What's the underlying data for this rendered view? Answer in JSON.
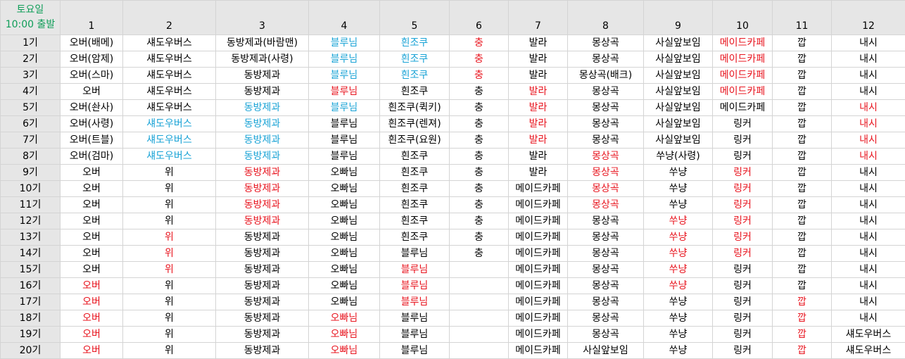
{
  "colors": {
    "black": "#000000",
    "red": "#e8141e",
    "blue": "#1aa3d6",
    "green": "#0f9d58",
    "header_bg": "#e6e6e6",
    "grid": "#d4d4d4"
  },
  "corner": {
    "day": "토요일",
    "time": "10:00 출발"
  },
  "columns": [
    "1",
    "2",
    "3",
    "4",
    "5",
    "6",
    "7",
    "8",
    "9",
    "10",
    "11",
    "12"
  ],
  "rows": [
    {
      "label": "1기",
      "cells": [
        {
          "t": "오버(배메)",
          "c": "k"
        },
        {
          "t": "섀도우버스",
          "c": "k"
        },
        {
          "t": "동방제과(바람맨)",
          "c": "k"
        },
        {
          "t": "블루님",
          "c": "b"
        },
        {
          "t": "흰조쿠",
          "c": "b"
        },
        {
          "t": "충",
          "c": "r"
        },
        {
          "t": "발라",
          "c": "k"
        },
        {
          "t": "몽상곡",
          "c": "k"
        },
        {
          "t": "사실앞보임",
          "c": "k"
        },
        {
          "t": "메이드카페",
          "c": "r"
        },
        {
          "t": "깝",
          "c": "k"
        },
        {
          "t": "내시",
          "c": "k"
        }
      ]
    },
    {
      "label": "2기",
      "cells": [
        {
          "t": "오버(암제)",
          "c": "k"
        },
        {
          "t": "섀도우버스",
          "c": "k"
        },
        {
          "t": "동방제과(사령)",
          "c": "k"
        },
        {
          "t": "블루님",
          "c": "b"
        },
        {
          "t": "흰조쿠",
          "c": "b"
        },
        {
          "t": "충",
          "c": "r"
        },
        {
          "t": "발라",
          "c": "k"
        },
        {
          "t": "몽상곡",
          "c": "k"
        },
        {
          "t": "사실앞보임",
          "c": "k"
        },
        {
          "t": "메이드카페",
          "c": "r"
        },
        {
          "t": "깝",
          "c": "k"
        },
        {
          "t": "내시",
          "c": "k"
        }
      ]
    },
    {
      "label": "3기",
      "cells": [
        {
          "t": "오버(스마)",
          "c": "k"
        },
        {
          "t": "섀도우버스",
          "c": "k"
        },
        {
          "t": "동방제과",
          "c": "k"
        },
        {
          "t": "블루님",
          "c": "b"
        },
        {
          "t": "흰조쿠",
          "c": "b"
        },
        {
          "t": "충",
          "c": "r"
        },
        {
          "t": "발라",
          "c": "k"
        },
        {
          "t": "몽상곡(배크)",
          "c": "k"
        },
        {
          "t": "사실앞보임",
          "c": "k"
        },
        {
          "t": "메이드카페",
          "c": "r"
        },
        {
          "t": "깝",
          "c": "k"
        },
        {
          "t": "내시",
          "c": "k"
        }
      ]
    },
    {
      "label": "4기",
      "cells": [
        {
          "t": "오버",
          "c": "k"
        },
        {
          "t": "섀도우버스",
          "c": "k"
        },
        {
          "t": "동방제과",
          "c": "k"
        },
        {
          "t": "블루님",
          "c": "r"
        },
        {
          "t": "흰조쿠",
          "c": "k"
        },
        {
          "t": "충",
          "c": "k"
        },
        {
          "t": "발라",
          "c": "r"
        },
        {
          "t": "몽상곡",
          "c": "k"
        },
        {
          "t": "사실앞보임",
          "c": "k"
        },
        {
          "t": "메이드카페",
          "c": "r"
        },
        {
          "t": "깝",
          "c": "k"
        },
        {
          "t": "내시",
          "c": "k"
        }
      ]
    },
    {
      "label": "5기",
      "cells": [
        {
          "t": "오버(솬사)",
          "c": "k"
        },
        {
          "t": "섀도우버스",
          "c": "k"
        },
        {
          "t": "동방제과",
          "c": "b"
        },
        {
          "t": "블루님",
          "c": "b"
        },
        {
          "t": "흰조쿠(퀵키)",
          "c": "k"
        },
        {
          "t": "충",
          "c": "k"
        },
        {
          "t": "발라",
          "c": "r"
        },
        {
          "t": "몽상곡",
          "c": "k"
        },
        {
          "t": "사실앞보임",
          "c": "k"
        },
        {
          "t": "메이드카페",
          "c": "k"
        },
        {
          "t": "깝",
          "c": "k"
        },
        {
          "t": "내시",
          "c": "r"
        }
      ]
    },
    {
      "label": "6기",
      "cells": [
        {
          "t": "오버(사령)",
          "c": "k"
        },
        {
          "t": "섀도우버스",
          "c": "b"
        },
        {
          "t": "동방제과",
          "c": "b"
        },
        {
          "t": "블루님",
          "c": "k"
        },
        {
          "t": "흰조쿠(렌져)",
          "c": "k"
        },
        {
          "t": "충",
          "c": "k"
        },
        {
          "t": "발라",
          "c": "r"
        },
        {
          "t": "몽상곡",
          "c": "k"
        },
        {
          "t": "사실앞보임",
          "c": "k"
        },
        {
          "t": "링커",
          "c": "k"
        },
        {
          "t": "깝",
          "c": "k"
        },
        {
          "t": "내시",
          "c": "r"
        }
      ]
    },
    {
      "label": "7기",
      "cells": [
        {
          "t": "오버(트블)",
          "c": "k"
        },
        {
          "t": "섀도우버스",
          "c": "b"
        },
        {
          "t": "동방제과",
          "c": "b"
        },
        {
          "t": "블루님",
          "c": "k"
        },
        {
          "t": "흰조쿠(요원)",
          "c": "k"
        },
        {
          "t": "충",
          "c": "k"
        },
        {
          "t": "발라",
          "c": "r"
        },
        {
          "t": "몽상곡",
          "c": "k"
        },
        {
          "t": "사실앞보임",
          "c": "k"
        },
        {
          "t": "링커",
          "c": "k"
        },
        {
          "t": "깝",
          "c": "k"
        },
        {
          "t": "내시",
          "c": "r"
        }
      ]
    },
    {
      "label": "8기",
      "cells": [
        {
          "t": "오버(검마)",
          "c": "k"
        },
        {
          "t": "섀도우버스",
          "c": "b"
        },
        {
          "t": "동방제과",
          "c": "b"
        },
        {
          "t": "블루님",
          "c": "k"
        },
        {
          "t": "흰조쿠",
          "c": "k"
        },
        {
          "t": "충",
          "c": "k"
        },
        {
          "t": "발라",
          "c": "k"
        },
        {
          "t": "몽상곡",
          "c": "r"
        },
        {
          "t": "쑤냥(사령)",
          "c": "k"
        },
        {
          "t": "링커",
          "c": "k"
        },
        {
          "t": "깝",
          "c": "k"
        },
        {
          "t": "내시",
          "c": "r"
        }
      ]
    },
    {
      "label": "9기",
      "cells": [
        {
          "t": "오버",
          "c": "k"
        },
        {
          "t": "위",
          "c": "k"
        },
        {
          "t": "동방제과",
          "c": "r"
        },
        {
          "t": "오빠님",
          "c": "k"
        },
        {
          "t": "흰조쿠",
          "c": "k"
        },
        {
          "t": "충",
          "c": "k"
        },
        {
          "t": "발라",
          "c": "k"
        },
        {
          "t": "몽상곡",
          "c": "r"
        },
        {
          "t": "쑤냥",
          "c": "k"
        },
        {
          "t": "링커",
          "c": "r"
        },
        {
          "t": "깝",
          "c": "k"
        },
        {
          "t": "내시",
          "c": "k"
        }
      ]
    },
    {
      "label": "10기",
      "cells": [
        {
          "t": "오버",
          "c": "k"
        },
        {
          "t": "위",
          "c": "k"
        },
        {
          "t": "동방제과",
          "c": "r"
        },
        {
          "t": "오빠님",
          "c": "k"
        },
        {
          "t": "흰조쿠",
          "c": "k"
        },
        {
          "t": "충",
          "c": "k"
        },
        {
          "t": "메이드카페",
          "c": "k"
        },
        {
          "t": "몽상곡",
          "c": "r"
        },
        {
          "t": "쑤냥",
          "c": "k"
        },
        {
          "t": "링커",
          "c": "r"
        },
        {
          "t": "깝",
          "c": "k"
        },
        {
          "t": "내시",
          "c": "k"
        }
      ]
    },
    {
      "label": "11기",
      "cells": [
        {
          "t": "오버",
          "c": "k"
        },
        {
          "t": "위",
          "c": "k"
        },
        {
          "t": "동방제과",
          "c": "r"
        },
        {
          "t": "오빠님",
          "c": "k"
        },
        {
          "t": "흰조쿠",
          "c": "k"
        },
        {
          "t": "충",
          "c": "k"
        },
        {
          "t": "메이드카페",
          "c": "k"
        },
        {
          "t": "몽상곡",
          "c": "r"
        },
        {
          "t": "쑤냥",
          "c": "k"
        },
        {
          "t": "링커",
          "c": "r"
        },
        {
          "t": "깝",
          "c": "k"
        },
        {
          "t": "내시",
          "c": "k"
        }
      ]
    },
    {
      "label": "12기",
      "cells": [
        {
          "t": "오버",
          "c": "k"
        },
        {
          "t": "위",
          "c": "k"
        },
        {
          "t": "동방제과",
          "c": "r"
        },
        {
          "t": "오빠님",
          "c": "k"
        },
        {
          "t": "흰조쿠",
          "c": "k"
        },
        {
          "t": "충",
          "c": "k"
        },
        {
          "t": "메이드카페",
          "c": "k"
        },
        {
          "t": "몽상곡",
          "c": "k"
        },
        {
          "t": "쑤냥",
          "c": "r"
        },
        {
          "t": "링커",
          "c": "r"
        },
        {
          "t": "깝",
          "c": "k"
        },
        {
          "t": "내시",
          "c": "k"
        }
      ]
    },
    {
      "label": "13기",
      "cells": [
        {
          "t": "오버",
          "c": "k"
        },
        {
          "t": "위",
          "c": "r"
        },
        {
          "t": "동방제과",
          "c": "k"
        },
        {
          "t": "오빠님",
          "c": "k"
        },
        {
          "t": "흰조쿠",
          "c": "k"
        },
        {
          "t": "충",
          "c": "k"
        },
        {
          "t": "메이드카페",
          "c": "k"
        },
        {
          "t": "몽상곡",
          "c": "k"
        },
        {
          "t": "쑤냥",
          "c": "r"
        },
        {
          "t": "링커",
          "c": "r"
        },
        {
          "t": "깝",
          "c": "k"
        },
        {
          "t": "내시",
          "c": "k"
        }
      ]
    },
    {
      "label": "14기",
      "cells": [
        {
          "t": "오버",
          "c": "k"
        },
        {
          "t": "위",
          "c": "r"
        },
        {
          "t": "동방제과",
          "c": "k"
        },
        {
          "t": "오빠님",
          "c": "k"
        },
        {
          "t": "블루님",
          "c": "k"
        },
        {
          "t": "충",
          "c": "k"
        },
        {
          "t": "메이드카페",
          "c": "k"
        },
        {
          "t": "몽상곡",
          "c": "k"
        },
        {
          "t": "쑤냥",
          "c": "r"
        },
        {
          "t": "링커",
          "c": "r"
        },
        {
          "t": "깝",
          "c": "k"
        },
        {
          "t": "내시",
          "c": "k"
        }
      ]
    },
    {
      "label": "15기",
      "cells": [
        {
          "t": "오버",
          "c": "k"
        },
        {
          "t": "위",
          "c": "r"
        },
        {
          "t": "동방제과",
          "c": "k"
        },
        {
          "t": "오빠님",
          "c": "k"
        },
        {
          "t": "블루님",
          "c": "r"
        },
        {
          "t": "",
          "c": "k"
        },
        {
          "t": "메이드카페",
          "c": "k"
        },
        {
          "t": "몽상곡",
          "c": "k"
        },
        {
          "t": "쑤냥",
          "c": "r"
        },
        {
          "t": "링커",
          "c": "k"
        },
        {
          "t": "깝",
          "c": "k"
        },
        {
          "t": "내시",
          "c": "k"
        }
      ]
    },
    {
      "label": "16기",
      "cells": [
        {
          "t": "오버",
          "c": "r"
        },
        {
          "t": "위",
          "c": "k"
        },
        {
          "t": "동방제과",
          "c": "k"
        },
        {
          "t": "오빠님",
          "c": "k"
        },
        {
          "t": "블루님",
          "c": "r"
        },
        {
          "t": "",
          "c": "k"
        },
        {
          "t": "메이드카페",
          "c": "k"
        },
        {
          "t": "몽상곡",
          "c": "k"
        },
        {
          "t": "쑤냥",
          "c": "r"
        },
        {
          "t": "링커",
          "c": "k"
        },
        {
          "t": "깝",
          "c": "k"
        },
        {
          "t": "내시",
          "c": "k"
        }
      ]
    },
    {
      "label": "17기",
      "cells": [
        {
          "t": "오버",
          "c": "r"
        },
        {
          "t": "위",
          "c": "k"
        },
        {
          "t": "동방제과",
          "c": "k"
        },
        {
          "t": "오빠님",
          "c": "k"
        },
        {
          "t": "블루님",
          "c": "r"
        },
        {
          "t": "",
          "c": "k"
        },
        {
          "t": "메이드카페",
          "c": "k"
        },
        {
          "t": "몽상곡",
          "c": "k"
        },
        {
          "t": "쑤냥",
          "c": "k"
        },
        {
          "t": "링커",
          "c": "k"
        },
        {
          "t": "깝",
          "c": "r"
        },
        {
          "t": "내시",
          "c": "k"
        }
      ]
    },
    {
      "label": "18기",
      "cells": [
        {
          "t": "오버",
          "c": "r"
        },
        {
          "t": "위",
          "c": "k"
        },
        {
          "t": "동방제과",
          "c": "k"
        },
        {
          "t": "오빠님",
          "c": "r"
        },
        {
          "t": "블루님",
          "c": "k"
        },
        {
          "t": "",
          "c": "k"
        },
        {
          "t": "메이드카페",
          "c": "k"
        },
        {
          "t": "몽상곡",
          "c": "k"
        },
        {
          "t": "쑤냥",
          "c": "k"
        },
        {
          "t": "링커",
          "c": "k"
        },
        {
          "t": "깝",
          "c": "r"
        },
        {
          "t": "내시",
          "c": "k"
        }
      ]
    },
    {
      "label": "19기",
      "cells": [
        {
          "t": "오버",
          "c": "r"
        },
        {
          "t": "위",
          "c": "k"
        },
        {
          "t": "동방제과",
          "c": "k"
        },
        {
          "t": "오빠님",
          "c": "r"
        },
        {
          "t": "블루님",
          "c": "k"
        },
        {
          "t": "",
          "c": "k"
        },
        {
          "t": "메이드카페",
          "c": "k"
        },
        {
          "t": "몽상곡",
          "c": "k"
        },
        {
          "t": "쑤냥",
          "c": "k"
        },
        {
          "t": "링커",
          "c": "k"
        },
        {
          "t": "깝",
          "c": "r"
        },
        {
          "t": "섀도우버스",
          "c": "k"
        }
      ]
    },
    {
      "label": "20기",
      "cells": [
        {
          "t": "오버",
          "c": "r"
        },
        {
          "t": "위",
          "c": "k"
        },
        {
          "t": "동방제과",
          "c": "k"
        },
        {
          "t": "오빠님",
          "c": "r"
        },
        {
          "t": "블루님",
          "c": "k"
        },
        {
          "t": "",
          "c": "k"
        },
        {
          "t": "메이드카페",
          "c": "k"
        },
        {
          "t": "사실앞보임",
          "c": "k"
        },
        {
          "t": "쑤냥",
          "c": "k"
        },
        {
          "t": "링커",
          "c": "k"
        },
        {
          "t": "깝",
          "c": "r"
        },
        {
          "t": "섀도우버스",
          "c": "k"
        }
      ]
    }
  ]
}
